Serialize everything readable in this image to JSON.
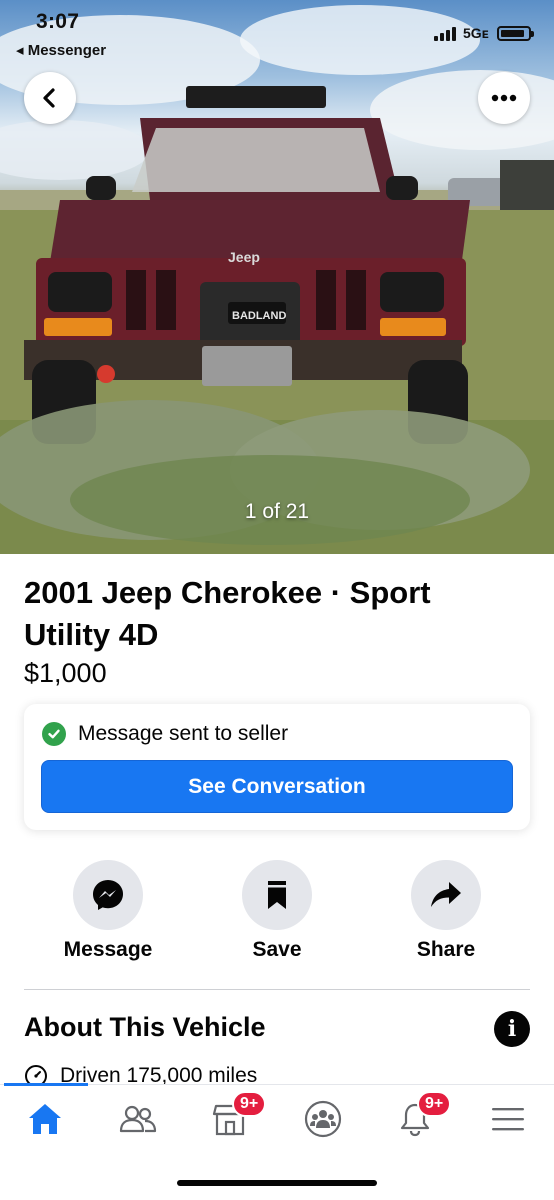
{
  "status_bar": {
    "time": "3:07",
    "back_app": "◂ Messenger",
    "network": "5Gᴇ",
    "battery_level": 0.9
  },
  "photo": {
    "counter": "1 of 21",
    "grille_badge": "Jeep",
    "winch_brand": "BADLAND"
  },
  "listing": {
    "title": "2001 Jeep Cherokee · Sport Utility 4D",
    "price": "$1,000"
  },
  "message_card": {
    "status_text": "Message sent to seller",
    "button_label": "See Conversation"
  },
  "actions": [
    {
      "label": "Message",
      "icon": "messenger-icon"
    },
    {
      "label": "Save",
      "icon": "bookmark-icon"
    },
    {
      "label": "Share",
      "icon": "share-arrow-icon"
    }
  ],
  "about": {
    "heading": "About This Vehicle",
    "driven": "Driven 175,000 miles"
  },
  "tabbar": {
    "tabs": [
      {
        "name": "home",
        "icon": "home-icon",
        "active": true
      },
      {
        "name": "friends",
        "icon": "friends-icon"
      },
      {
        "name": "marketplace",
        "icon": "marketplace-icon",
        "badge": "9+"
      },
      {
        "name": "groups",
        "icon": "groups-icon"
      },
      {
        "name": "notifications",
        "icon": "bell-icon",
        "badge": "9+"
      },
      {
        "name": "menu",
        "icon": "menu-icon"
      }
    ]
  },
  "colors": {
    "accent": "#1877f2",
    "success": "#31a24c",
    "badge": "#e41e3f"
  }
}
